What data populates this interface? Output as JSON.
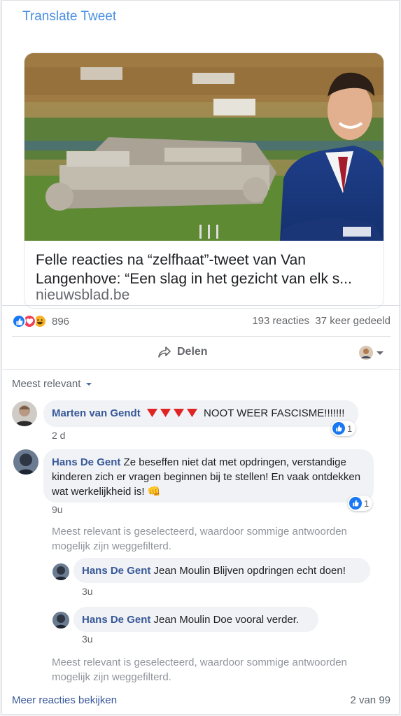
{
  "translate_label": "Translate Tweet",
  "link_card": {
    "title": "Felle reacties na “zelfhaat”-tweet van Van Langenhove: “Een slag in het gezicht van elk s...",
    "domain": "nieuwsblad.be"
  },
  "reactions": {
    "icons": [
      "like-icon",
      "love-icon",
      "haha-icon"
    ],
    "count": "896",
    "comments": "193 reacties",
    "shares": "37 keer gedeeld"
  },
  "actions": {
    "share_label": "Delen"
  },
  "sort": {
    "label": "Meest relevant"
  },
  "comments": [
    {
      "author": "Marten van Gendt",
      "text": "NOOT WEER FASCISME!!!!!!!",
      "emoji": "red-triangle-icon",
      "time": "2 d",
      "likes": "1"
    },
    {
      "author": "Hans De Gent",
      "text": "Ze beseffen niet dat met opdringen, verstandige kinderen zich er vragen beginnen bij te stellen! En vaak ontdekken wat werkelijkheid is! 👊",
      "time": "9u",
      "likes": "1"
    }
  ],
  "filter_note": "Meest relevant is geselecteerd, waardoor sommige antwoorden mogelijk zijn weggefilterd.",
  "replies": [
    {
      "author": "Hans De Gent",
      "text": "Jean Moulin Blijven opdringen echt doen!",
      "time": "3u"
    },
    {
      "author": "Hans De Gent",
      "text": "Jean Moulin Doe vooral verder.",
      "time": "3u"
    }
  ],
  "footer": {
    "more_label": "Meer reacties bekijken",
    "pagination": "2 van 99"
  },
  "colors": {
    "link_blue": "#385898",
    "like_blue": "#1877f2",
    "love_red": "#f33e58",
    "haha_yellow": "#f7b125"
  }
}
